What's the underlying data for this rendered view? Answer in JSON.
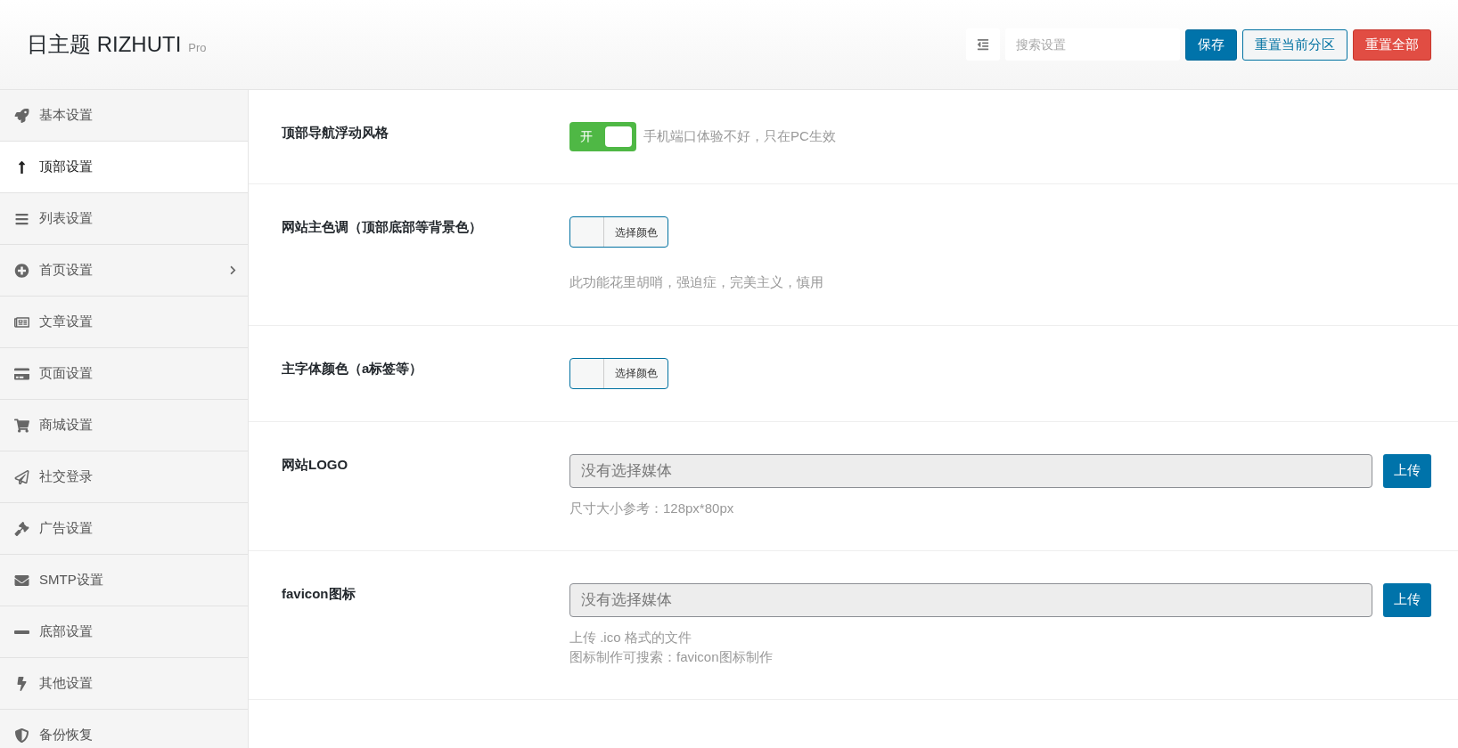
{
  "header": {
    "title": "日主题 RIZHUTI",
    "badge": "Pro",
    "search": {
      "placeholder": "搜索设置"
    },
    "buttons": [
      {
        "label": "保存",
        "kind": "primary"
      },
      {
        "label": "重置当前分区",
        "kind": "secondary"
      },
      {
        "label": "重置全部",
        "kind": "danger"
      }
    ]
  },
  "sidebar": {
    "items": [
      {
        "label": "基本设置",
        "selected": false,
        "expandable": false
      },
      {
        "label": "顶部设置",
        "selected": true,
        "expandable": false
      },
      {
        "label": "列表设置",
        "selected": false,
        "expandable": false
      },
      {
        "label": "首页设置",
        "selected": false,
        "expandable": true
      },
      {
        "label": "文章设置",
        "selected": false,
        "expandable": false
      },
      {
        "label": "页面设置",
        "selected": false,
        "expandable": false
      },
      {
        "label": "商城设置",
        "selected": false,
        "expandable": false
      },
      {
        "label": "社交登录",
        "selected": false,
        "expandable": false
      },
      {
        "label": "广告设置",
        "selected": false,
        "expandable": false
      },
      {
        "label": "SMTP设置",
        "selected": false,
        "expandable": false
      },
      {
        "label": "底部设置",
        "selected": false,
        "expandable": false
      },
      {
        "label": "其他设置",
        "selected": false,
        "expandable": false
      },
      {
        "label": "备份恢复",
        "selected": false,
        "expandable": false
      }
    ]
  },
  "fields": [
    {
      "kind": "switch",
      "label": "顶部导航浮动风格",
      "on": true,
      "switch_label": "开",
      "notes": [
        "手机端口体验不好，只在PC生效"
      ]
    },
    {
      "kind": "color",
      "label": "网站主色调（顶部底部等背景色）",
      "button": "选择颜色",
      "notes": [
        "此功能花里胡哨，强迫症，完美主义，慎用"
      ]
    },
    {
      "kind": "color",
      "label": "主字体颜色（a标签等）",
      "button": "选择颜色"
    },
    {
      "kind": "media",
      "label": "网站LOGO",
      "placeholder": "没有选择媒体",
      "button": "上传",
      "notes": [
        "尺寸大小参考：128px*80px"
      ]
    },
    {
      "kind": "media",
      "label": "favicon图标",
      "placeholder": "没有选择媒体",
      "button": "上传",
      "notes": [
        "上传 .ico 格式的文件",
        "图标制作可搜索：favicon图标制作"
      ]
    }
  ]
}
